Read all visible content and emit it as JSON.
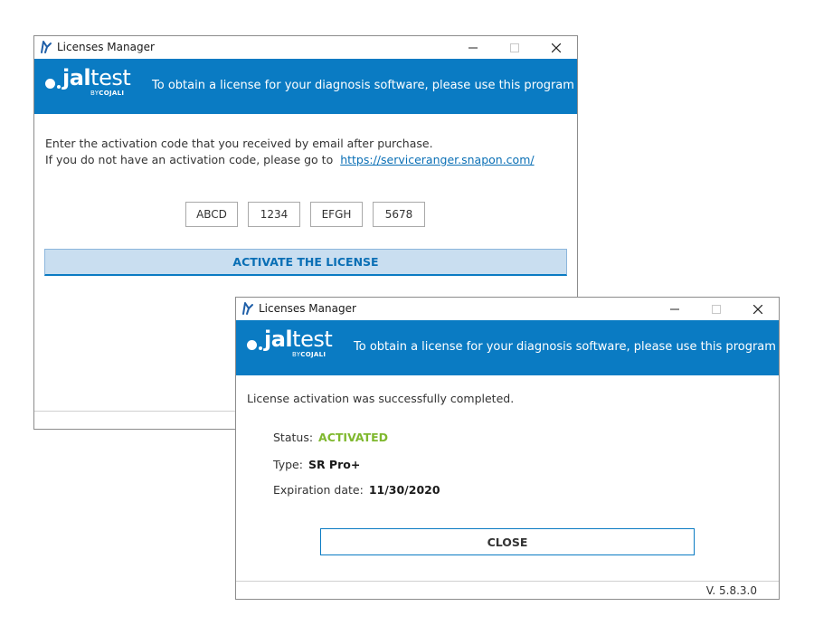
{
  "back_window": {
    "title": "Licenses Manager",
    "banner": {
      "logo_light": "․",
      "logo_bold": "jal",
      "logo_rest": "test",
      "logo_by": "BY",
      "logo_brand": "COJALI",
      "tagline": "To obtain a license for your diagnosis software, please use this program"
    },
    "instruction_line1": "Enter the activation code that you received by email after purchase.",
    "instruction_line2": "If you do not have an activation code, please go to",
    "link": "https://serviceranger.snapon.com/",
    "codes": [
      "ABCD",
      "1234",
      "EFGH",
      "5678"
    ],
    "activate_label": "ACTIVATE THE LICENSE"
  },
  "front_window": {
    "title": "Licenses Manager",
    "banner": {
      "logo_bold": "jal",
      "logo_rest": "test",
      "logo_by": "BY",
      "logo_brand": "COJALI",
      "tagline": "To obtain a license for your diagnosis software, please use this program"
    },
    "success_message": "License activation was successfully completed.",
    "status_label": "Status:",
    "status_value": "ACTIVATED",
    "type_label": "Type:",
    "type_value": "SR Pro+",
    "expiration_label": "Expiration date:",
    "expiration_value": "11/30/2020",
    "close_label": "CLOSE",
    "version": "V. 5.8.3.0"
  },
  "colors": {
    "banner_blue": "#0a7bc3",
    "activated_green": "#7fb82e",
    "activate_button_bg": "#c9def0",
    "link_blue": "#0a6fb5"
  },
  "icons": {
    "app": "jaltest-app-icon",
    "minimize": "minimize-icon",
    "maximize": "maximize-icon",
    "close": "close-icon"
  }
}
